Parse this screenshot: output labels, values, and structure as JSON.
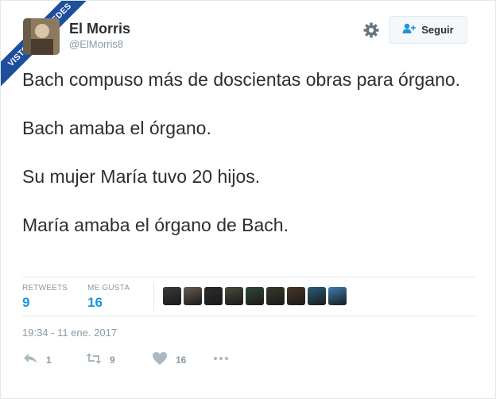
{
  "watermark": {
    "text": "VISTOENLASREDES"
  },
  "user": {
    "name": "El Morris",
    "handle": "@ElMorris8"
  },
  "follow_button": {
    "label": "Seguir",
    "icon": "add-user-icon"
  },
  "settings": {
    "icon": "gear-icon"
  },
  "tweet": {
    "lines": [
      "Bach compuso más de doscientas obras para órgano.",
      "Bach amaba el órgano.",
      "Su mujer María tuvo 20 hijos.",
      "María amaba el órgano de Bach."
    ]
  },
  "stats": {
    "retweets": {
      "label": "RETWEETS",
      "count": "9"
    },
    "likes": {
      "label": "ME GUSTA",
      "count": "16"
    }
  },
  "likers_colors": [
    "#3b3b3b",
    "#6b5b4f",
    "#2c2c2c",
    "#4a4a3a",
    "#2f4a3a",
    "#3a3a2e",
    "#4b3826",
    "#2b5d7a",
    "#3d7fb0"
  ],
  "timestamp": "19:34 - 11 ene. 2017",
  "actions": {
    "reply": {
      "icon": "reply-icon",
      "count": "1"
    },
    "retweet": {
      "icon": "retweet-icon",
      "count": "9"
    },
    "like": {
      "icon": "heart-icon",
      "count": "16"
    },
    "more": {
      "icon": "more-icon"
    }
  },
  "colors": {
    "accent": "#1b95e0",
    "muted": "#8899a6",
    "text": "#292f33",
    "ribbon": "#1e4f9c"
  }
}
